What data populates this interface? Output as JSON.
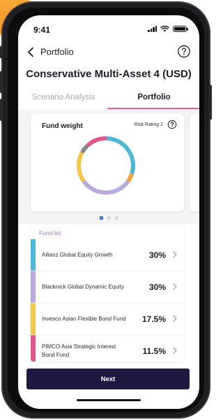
{
  "status_bar": {
    "time": "9:41"
  },
  "nav": {
    "back_icon": "chevron-left-icon",
    "title": "Portfolio",
    "help_icon": "question-circle-icon"
  },
  "page_title": "Conservative Multi-Asset 4 (USD)",
  "tabs": [
    {
      "label": "Scenario Analysis",
      "active": false
    },
    {
      "label": "Portfolio",
      "active": true
    }
  ],
  "fund_weight_card": {
    "title": "Fund weight",
    "risk_rating": "Risk Rating 2",
    "help_icon": "question-circle-icon",
    "donut": [
      {
        "color": "#4fb7d8",
        "value": 30
      },
      {
        "color": "#f0a33b",
        "value": 5
      },
      {
        "color": "#b9a9de",
        "value": 30
      },
      {
        "color": "#f3c847",
        "value": 17.5
      },
      {
        "color": "#888888",
        "value": 5
      },
      {
        "color": "#e4578c",
        "value": 11.5
      }
    ]
  },
  "pager": {
    "pages": 3,
    "active": 0
  },
  "fund_list": {
    "label": "Fund list",
    "items": [
      {
        "name": "Allianz Global Equity Growth",
        "percent": "30%",
        "color": "#4fb7d8"
      },
      {
        "name": "Blackrock Global Dynamic Equity",
        "percent": "30%",
        "color": "#b9a9de"
      },
      {
        "name": "Invesco Asian Flexible Bond Fund",
        "percent": "17.5%",
        "color": "#f3c847"
      },
      {
        "name": "PIMCO Asia Strategic Interest Bond Fund",
        "percent": "11.5%",
        "color": "#e4578c"
      }
    ]
  },
  "next_button": {
    "label": "Next"
  },
  "colors": {
    "accent": "#e45a8c",
    "primary_button": "#1f1840",
    "fund_list_label": "#a07cc8",
    "active_dot": "#3a7bd5"
  }
}
